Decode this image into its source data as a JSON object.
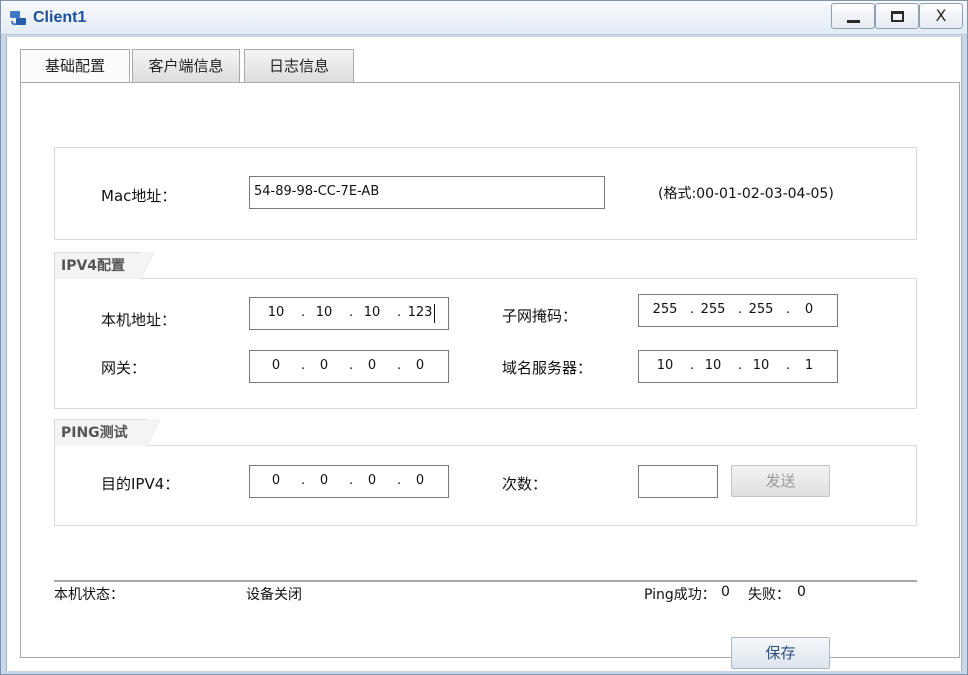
{
  "window": {
    "title": "Client1",
    "icon": "client-app-icon",
    "close_glyph": "X"
  },
  "tabs": [
    {
      "label": "基础配置",
      "active": true
    },
    {
      "label": "客户端信息",
      "active": false
    },
    {
      "label": "日志信息",
      "active": false
    }
  ],
  "mac": {
    "label": "Mac地址：",
    "value": "54-89-98-CC-7E-AB",
    "hint": "(格式:00-01-02-03-04-05)"
  },
  "ipv4": {
    "section_title": "IPV4配置",
    "local_addr": {
      "label": "本机地址：",
      "octets": [
        "10",
        "10",
        "10",
        "123"
      ]
    },
    "subnet_mask": {
      "label": "子网掩码：",
      "octets": [
        "255",
        "255",
        "255",
        "0"
      ]
    },
    "gateway": {
      "label": "网关：",
      "octets": [
        "0",
        "0",
        "0",
        "0"
      ]
    },
    "dns": {
      "label": "域名服务器：",
      "octets": [
        "10",
        "10",
        "10",
        "1"
      ]
    }
  },
  "ping": {
    "section_title": "PING测试",
    "dest": {
      "label": "目的IPV4：",
      "octets": [
        "0",
        "0",
        "0",
        "0"
      ]
    },
    "count": {
      "label": "次数：",
      "value": ""
    },
    "send_label": "发送"
  },
  "status": {
    "label": "本机状态：",
    "value": "设备关闭",
    "ping_success_label": "Ping成功：",
    "ping_success_value": "0",
    "fail_label": "失败：",
    "fail_value": "0"
  },
  "save_label": "保存",
  "colors": {
    "title_text": "#1c4fa0",
    "frame": "#c9d7e6",
    "button_text": "#2a4d7a"
  }
}
